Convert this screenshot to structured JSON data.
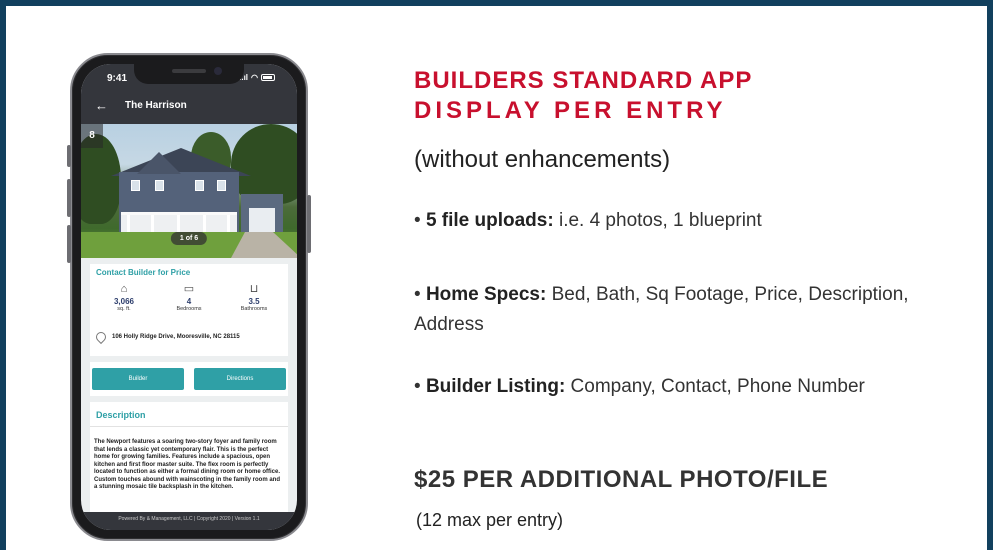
{
  "phone": {
    "status_time": "9:41",
    "status_signal": "..ıl",
    "header": {
      "back_icon": "arrow-left-icon",
      "title": "The Harrison"
    },
    "photo": {
      "index_badge": "8",
      "counter": "1 of 6"
    },
    "price_card": {
      "title": "Contact Builder for Price",
      "specs": [
        {
          "icon": "house-icon",
          "value": "3,066",
          "label": "sq. ft."
        },
        {
          "icon": "bed-icon",
          "value": "4",
          "label": "Bedrooms"
        },
        {
          "icon": "bathtub-icon",
          "value": "3.5",
          "label": "Bathrooms"
        }
      ],
      "address": "106 Holly Ridge Drive, Mooresville, NC 28115"
    },
    "actions": {
      "builder": "Builder",
      "directions": "Directions"
    },
    "description": {
      "title": "Description",
      "text": "The Newport features a soaring two-story foyer and family room that lends a classic yet contemporary flair. This is the perfect home for growing families. Features include a spacious, open kitchen and first floor master suite. The flex room is perfectly located to function as either a formal dining room or home office. Custom touches abound with wainscoting in the family room and a stunning mosaic tile backsplash in the kitchen."
    },
    "footer": "Powered By  &  Management, LLC | Copyright 2020 | Version 1.1"
  },
  "heading": {
    "line1": "BUILDERS STANDARD APP",
    "line2": "DISPLAY PER ENTRY",
    "subtitle": "(without enhancements)"
  },
  "bullets": [
    {
      "bold": "5 file uploads:",
      "text": " i.e. 4 photos, 1 blueprint"
    },
    {
      "bold": "Home Specs:",
      "text": " Bed, Bath, Sq Footage, Price, Description, Address"
    },
    {
      "bold": "Builder Listing:",
      "text": " Company, Contact, Phone Number"
    }
  ],
  "pricing": {
    "headline": "$25 PER ADDITIONAL PHOTO/FILE",
    "note": "(12 max per entry)"
  },
  "colors": {
    "frame": "#11405e",
    "accent_red": "#c8102e",
    "teal": "#2fa0a6",
    "app_dark": "#34363c"
  }
}
